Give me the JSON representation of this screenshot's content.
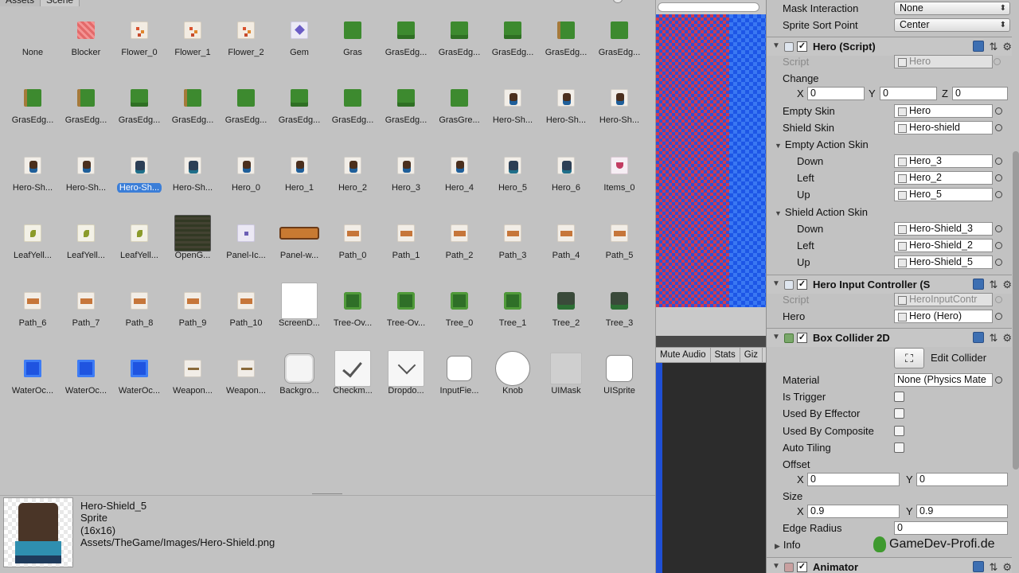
{
  "picker": {
    "tabs": [
      "Assets",
      "Scene"
    ],
    "items": [
      {
        "name": "None",
        "kind": "none"
      },
      {
        "name": "Blocker",
        "kind": "blocker"
      },
      {
        "name": "Flower_0",
        "kind": "flower"
      },
      {
        "name": "Flower_1",
        "kind": "flower"
      },
      {
        "name": "Flower_2",
        "kind": "flower"
      },
      {
        "name": "Gem",
        "kind": "gem"
      },
      {
        "name": "Gras",
        "kind": "grass"
      },
      {
        "name": "GrasEdg...",
        "kind": "edge"
      },
      {
        "name": "GrasEdg...",
        "kind": "edge"
      },
      {
        "name": "GrasEdg...",
        "kind": "edge"
      },
      {
        "name": "GrasEdg...",
        "kind": "edge2"
      },
      {
        "name": "GrasEdg...",
        "kind": "grass"
      },
      {
        "name": "GrasEdg...",
        "kind": "edge2"
      },
      {
        "name": "GrasEdg...",
        "kind": "edge2"
      },
      {
        "name": "GrasEdg...",
        "kind": "edge"
      },
      {
        "name": "GrasEdg...",
        "kind": "edge2"
      },
      {
        "name": "GrasEdg...",
        "kind": "grass"
      },
      {
        "name": "GrasEdg...",
        "kind": "edge"
      },
      {
        "name": "GrasEdg...",
        "kind": "grass"
      },
      {
        "name": "GrasEdg...",
        "kind": "edge"
      },
      {
        "name": "GrasGre...",
        "kind": "grass"
      },
      {
        "name": "Hero-Sh...",
        "kind": "hero"
      },
      {
        "name": "Hero-Sh...",
        "kind": "hero"
      },
      {
        "name": "Hero-Sh...",
        "kind": "hero"
      },
      {
        "name": "Hero-Sh...",
        "kind": "hero"
      },
      {
        "name": "Hero-Sh...",
        "kind": "hero"
      },
      {
        "name": "Hero-Sh...",
        "kind": "heroshield",
        "selected": true
      },
      {
        "name": "Hero-Sh...",
        "kind": "heroshield"
      },
      {
        "name": "Hero_0",
        "kind": "hero"
      },
      {
        "name": "Hero_1",
        "kind": "hero"
      },
      {
        "name": "Hero_2",
        "kind": "hero"
      },
      {
        "name": "Hero_3",
        "kind": "hero"
      },
      {
        "name": "Hero_4",
        "kind": "hero"
      },
      {
        "name": "Hero_5",
        "kind": "heroshield"
      },
      {
        "name": "Hero_6",
        "kind": "heroshield"
      },
      {
        "name": "Items_0",
        "kind": "item"
      },
      {
        "name": "LeafYell...",
        "kind": "leaf"
      },
      {
        "name": "LeafYell...",
        "kind": "leaf"
      },
      {
        "name": "LeafYell...",
        "kind": "leaf"
      },
      {
        "name": "OpenG...",
        "kind": "opengl"
      },
      {
        "name": "Panel-Ic...",
        "kind": "panelicon"
      },
      {
        "name": "Panel-w...",
        "kind": "panelw"
      },
      {
        "name": "Path_0",
        "kind": "path"
      },
      {
        "name": "Path_1",
        "kind": "path"
      },
      {
        "name": "Path_2",
        "kind": "path"
      },
      {
        "name": "Path_3",
        "kind": "path"
      },
      {
        "name": "Path_4",
        "kind": "path"
      },
      {
        "name": "Path_5",
        "kind": "path"
      },
      {
        "name": "Path_6",
        "kind": "path"
      },
      {
        "name": "Path_7",
        "kind": "path"
      },
      {
        "name": "Path_8",
        "kind": "path"
      },
      {
        "name": "Path_9",
        "kind": "path"
      },
      {
        "name": "Path_10",
        "kind": "path"
      },
      {
        "name": "ScreenD...",
        "kind": "white"
      },
      {
        "name": "Tree-Ov...",
        "kind": "tree"
      },
      {
        "name": "Tree-Ov...",
        "kind": "tree"
      },
      {
        "name": "Tree_0",
        "kind": "tree"
      },
      {
        "name": "Tree_1",
        "kind": "tree"
      },
      {
        "name": "Tree_2",
        "kind": "treedark"
      },
      {
        "name": "Tree_3",
        "kind": "treedark"
      },
      {
        "name": "WaterOc...",
        "kind": "water"
      },
      {
        "name": "WaterOc...",
        "kind": "water"
      },
      {
        "name": "WaterOc...",
        "kind": "water"
      },
      {
        "name": "Weapon...",
        "kind": "weapon"
      },
      {
        "name": "Weapon...",
        "kind": "weapon"
      },
      {
        "name": "Backgro...",
        "kind": "uibox"
      },
      {
        "name": "Checkm...",
        "kind": "check"
      },
      {
        "name": "Dropdo...",
        "kind": "dropdown"
      },
      {
        "name": "InputFie...",
        "kind": "input"
      },
      {
        "name": "Knob",
        "kind": "knob"
      },
      {
        "name": "UIMask",
        "kind": "mask"
      },
      {
        "name": "UISprite",
        "kind": "uisprite"
      }
    ],
    "preview": {
      "name": "Hero-Shield_5",
      "type": "Sprite",
      "size": "(16x16)",
      "path": "Assets/TheGame/Images/Hero-Shield.png"
    }
  },
  "game_bar": {
    "mute_audio": "Mute Audio",
    "stats": "Stats",
    "gizmos": "Giz"
  },
  "inspector": {
    "mask_interaction": {
      "label": "Mask Interaction",
      "value": "None"
    },
    "sprite_sort_point": {
      "label": "Sprite Sort Point",
      "value": "Center"
    },
    "hero_script": {
      "title": "Hero (Script)",
      "script_label": "Script",
      "script_value": "Hero",
      "change_label": "Change",
      "x_label": "X",
      "x": "0",
      "y_label": "Y",
      "y": "0",
      "z_label": "Z",
      "z": "0",
      "empty_skin_label": "Empty Skin",
      "empty_skin": "Hero",
      "shield_skin_label": "Shield Skin",
      "shield_skin": "Hero-shield",
      "empty_action_label": "Empty Action Skin",
      "empty_down_label": "Down",
      "empty_down": "Hero_3",
      "empty_left_label": "Left",
      "empty_left": "Hero_2",
      "empty_up_label": "Up",
      "empty_up": "Hero_5",
      "shield_action_label": "Shield Action Skin",
      "shield_down_label": "Down",
      "shield_down": "Hero-Shield_3",
      "shield_left_label": "Left",
      "shield_left": "Hero-Shield_2",
      "shield_up_label": "Up",
      "shield_up": "Hero-Shield_5"
    },
    "input_controller": {
      "title": "Hero Input Controller (S",
      "script_label": "Script",
      "script_value": "HeroInputContr",
      "hero_label": "Hero",
      "hero_value": "Hero (Hero)"
    },
    "box_collider": {
      "title": "Box Collider 2D",
      "edit_collider": "Edit Collider",
      "material_label": "Material",
      "material_value": "None (Physics Mate",
      "is_trigger": "Is Trigger",
      "used_by_effector": "Used By Effector",
      "used_by_composite": "Used By Composite",
      "auto_tiling": "Auto Tiling",
      "offset_label": "Offset",
      "offset_x_label": "X",
      "offset_x": "0",
      "offset_y_label": "Y",
      "offset_y": "0",
      "size_label": "Size",
      "size_x_label": "X",
      "size_x": "0.9",
      "size_y_label": "Y",
      "size_y": "0.9",
      "edge_radius_label": "Edge Radius",
      "edge_radius": "0",
      "info_label": "Info"
    },
    "animator": {
      "title": "Animator"
    }
  },
  "watermark": "GameDev-Profi.de"
}
